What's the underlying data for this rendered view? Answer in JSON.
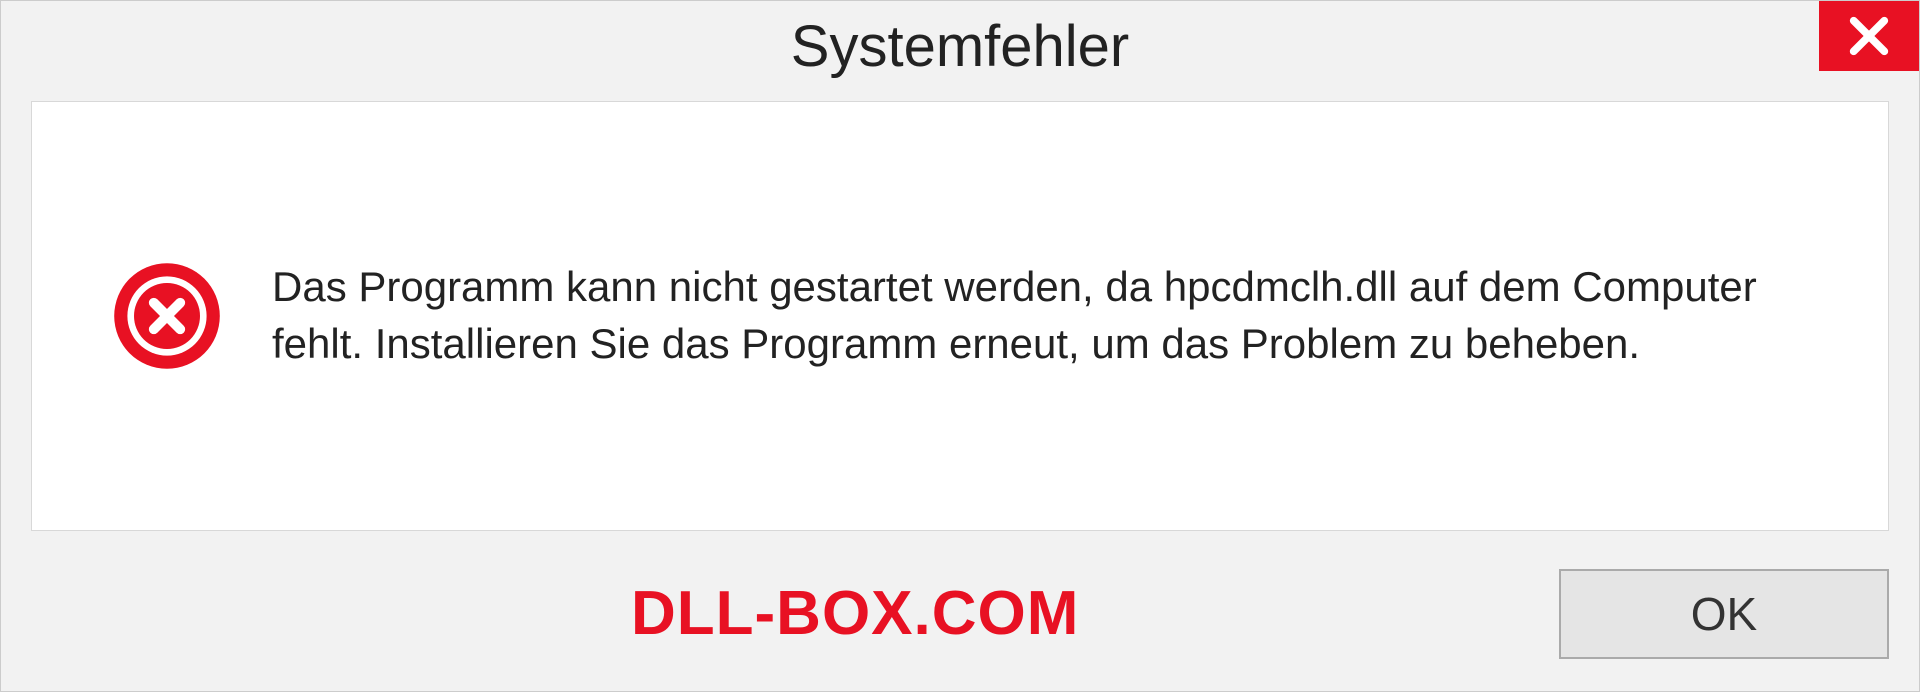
{
  "dialog": {
    "title": "Systemfehler",
    "message": "Das Programm kann nicht gestartet werden, da hpcdmclh.dll auf dem Computer fehlt. Installieren Sie das Programm erneut, um das Problem zu beheben.",
    "ok_label": "OK",
    "watermark": "DLL-BOX.COM"
  }
}
